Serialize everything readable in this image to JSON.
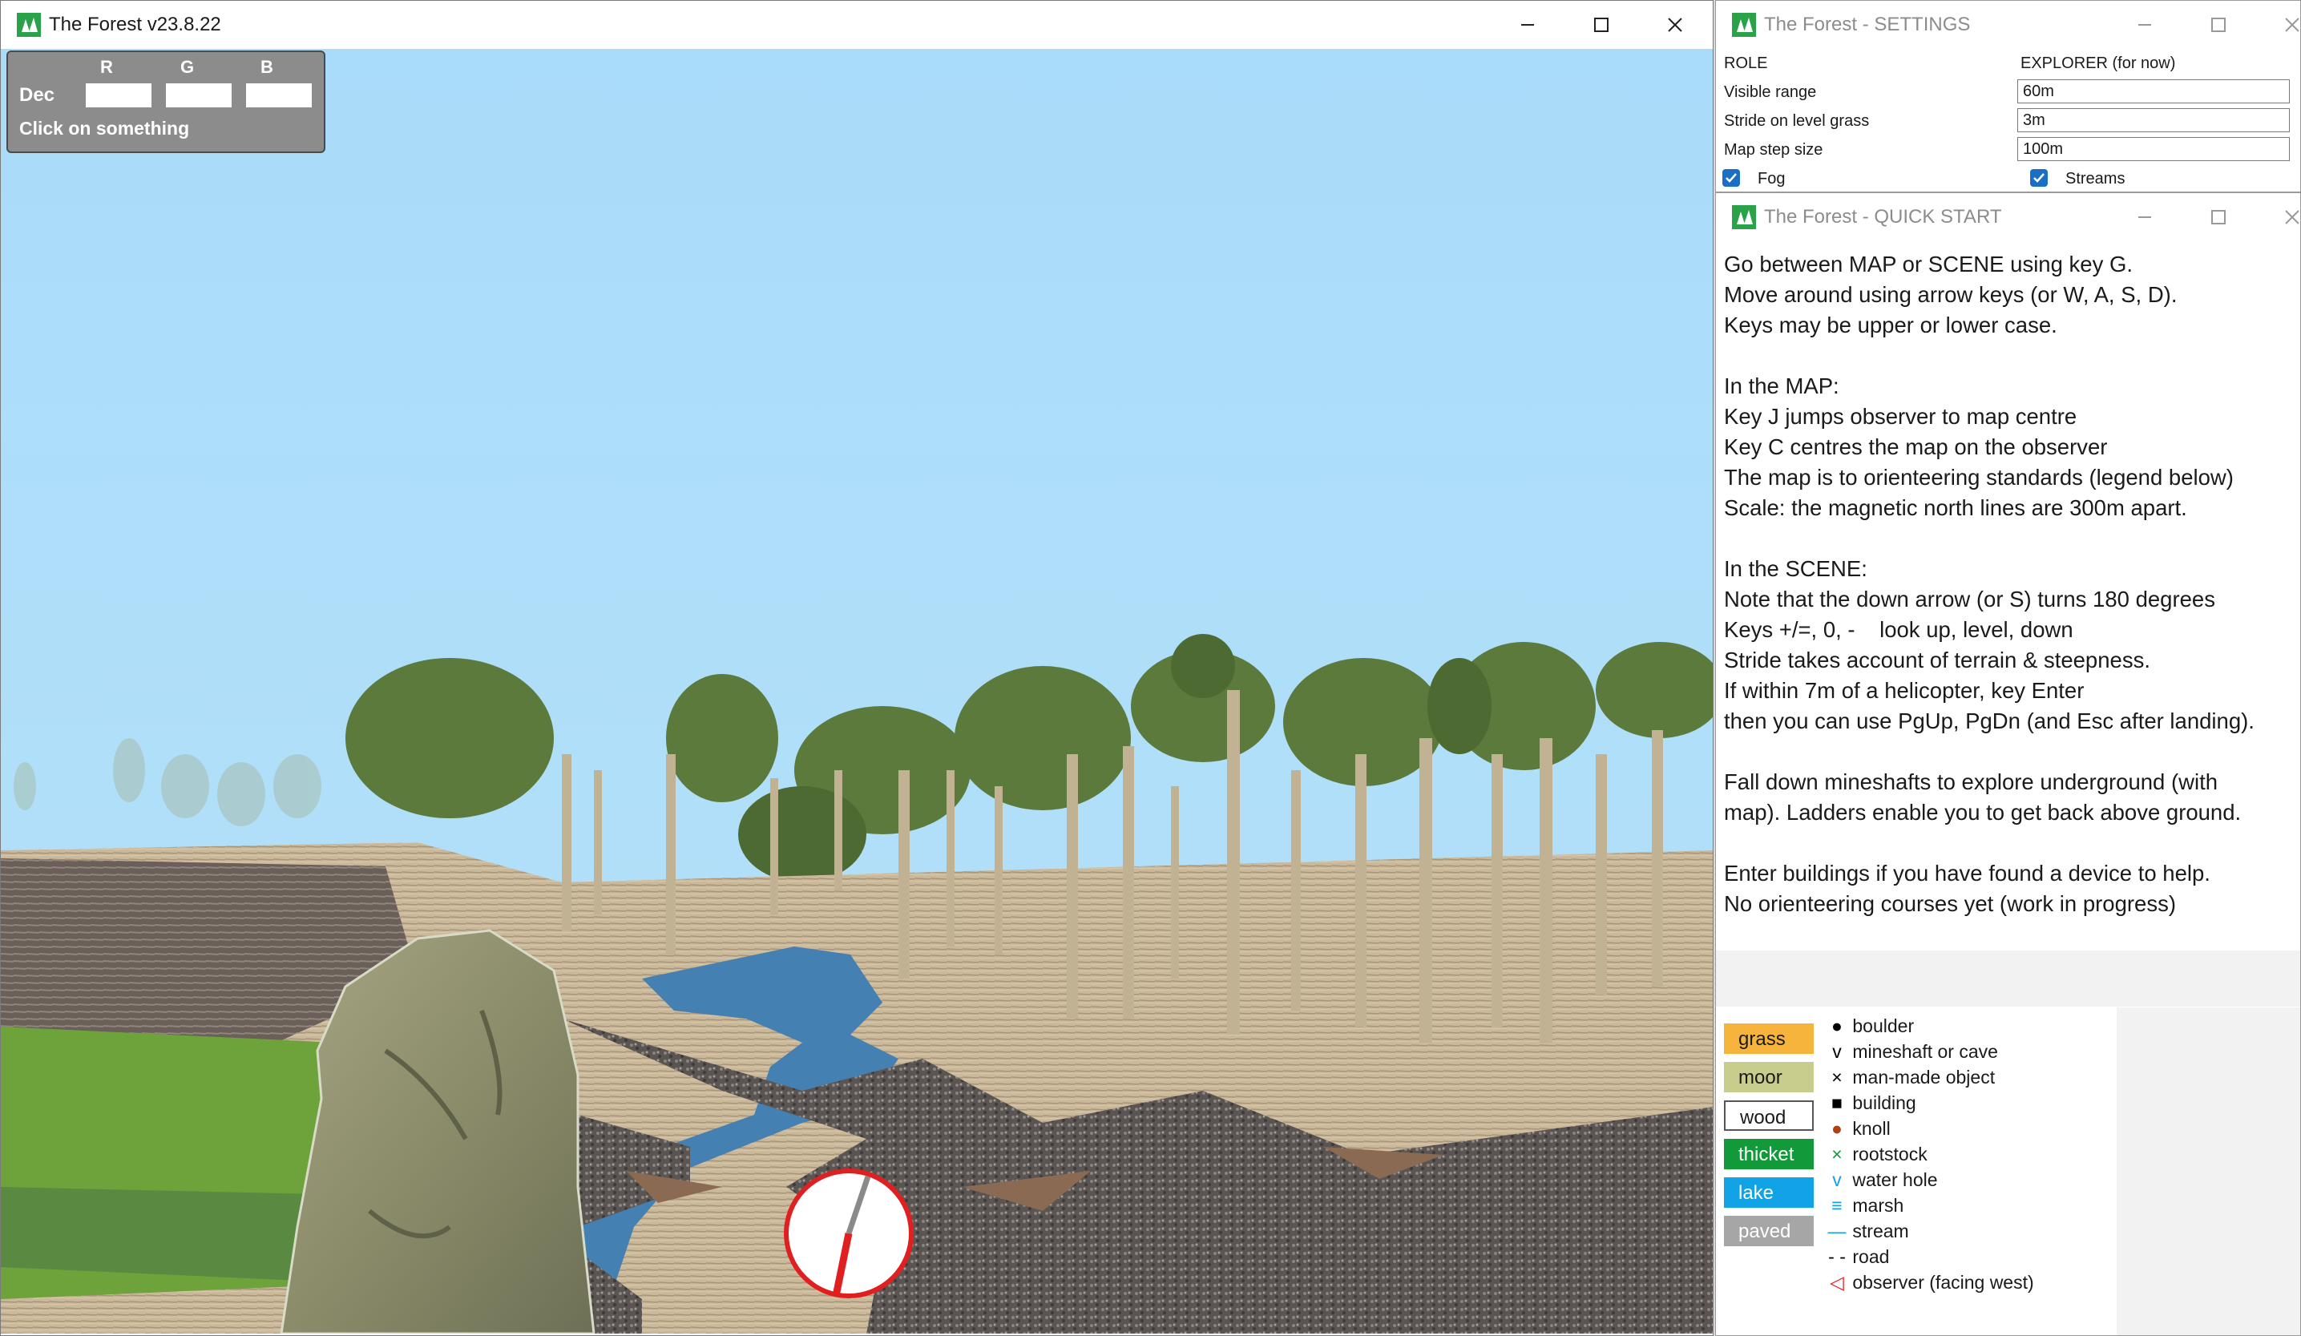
{
  "main_window": {
    "title": "The Forest v23.8.22",
    "rgb_panel": {
      "headers": [
        "R",
        "G",
        "B"
      ],
      "row_label": "Dec",
      "message": "Click on something"
    }
  },
  "settings_window": {
    "title": "The Forest - SETTINGS",
    "role_label": "ROLE",
    "role_value": "EXPLORER (for now)",
    "fields": [
      {
        "label": "Visible range",
        "value": "60m"
      },
      {
        "label": "Stride on level grass",
        "value": "3m"
      },
      {
        "label": "Map step size",
        "value": "100m"
      }
    ],
    "checkboxes": [
      {
        "label": "Fog",
        "checked": true
      },
      {
        "label": "Streams",
        "checked": true
      }
    ]
  },
  "quickstart_window": {
    "title": "The Forest - QUICK START",
    "lines": [
      "Go between MAP or SCENE using key G.",
      "Move around using arrow keys (or W, A, S, D).",
      "Keys may be upper or lower case.",
      "",
      "In the MAP:",
      "Key J jumps observer to map centre",
      "Key C centres the map on the observer",
      "The map is to orienteering standards (legend below)",
      "Scale: the magnetic north lines are 300m apart.",
      "",
      "In the SCENE:",
      "Note that the down arrow (or S) turns 180 degrees",
      "Keys +/=, 0, -    look up, level, down",
      "Stride takes account of terrain & steepness.",
      "If within 7m of a helicopter, key Enter",
      "then you can use PgUp, PgDn (and Esc after landing).",
      "",
      "Fall down mineshafts to explore underground (with",
      "map). Ladders enable you to get back above ground.",
      "",
      "Enter buildings if you have found a device to help.",
      "No orienteering courses yet (work in progress)"
    ],
    "legend_areas": [
      {
        "label": "grass",
        "bg": "#f7b43c",
        "fg": "#1a1a1a"
      },
      {
        "label": "moor",
        "bg": "#c8cc8c",
        "fg": "#1a1a1a"
      },
      {
        "label": "wood",
        "bg": "#ffffff",
        "fg": "#1a1a1a"
      },
      {
        "label": "thicket",
        "bg": "#129a3a",
        "fg": "#ffffff"
      },
      {
        "label": "lake",
        "bg": "#12a2e6",
        "fg": "#ffffff"
      },
      {
        "label": "paved",
        "bg": "#a6a6a6",
        "fg": "#ffffff"
      }
    ],
    "legend_symbols": [
      {
        "icon": "boulder-icon",
        "glyph": "●",
        "color": "#000000",
        "label": "boulder"
      },
      {
        "icon": "mineshaft-icon",
        "glyph": "v",
        "color": "#000000",
        "label": "mineshaft or cave"
      },
      {
        "icon": "man-made-object-icon",
        "glyph": "×",
        "color": "#000000",
        "label": "man-made object"
      },
      {
        "icon": "building-icon",
        "glyph": "■",
        "color": "#000000",
        "label": "building"
      },
      {
        "icon": "knoll-icon",
        "glyph": "●",
        "color": "#b04010",
        "label": "knoll"
      },
      {
        "icon": "rootstock-icon",
        "glyph": "×",
        "color": "#129a3a",
        "label": "rootstock"
      },
      {
        "icon": "water-hole-icon",
        "glyph": "v",
        "color": "#12a2e6",
        "label": "water hole"
      },
      {
        "icon": "marsh-icon",
        "glyph": "≡",
        "color": "#12a2e6",
        "label": "marsh"
      },
      {
        "icon": "stream-icon",
        "glyph": "—",
        "color": "#12a2e6",
        "label": "stream"
      },
      {
        "icon": "road-icon",
        "glyph": "- -",
        "color": "#000000",
        "label": "road"
      },
      {
        "icon": "observer-icon",
        "glyph": "◁",
        "color": "#e41a1a",
        "label": "observer (facing west)"
      }
    ]
  }
}
